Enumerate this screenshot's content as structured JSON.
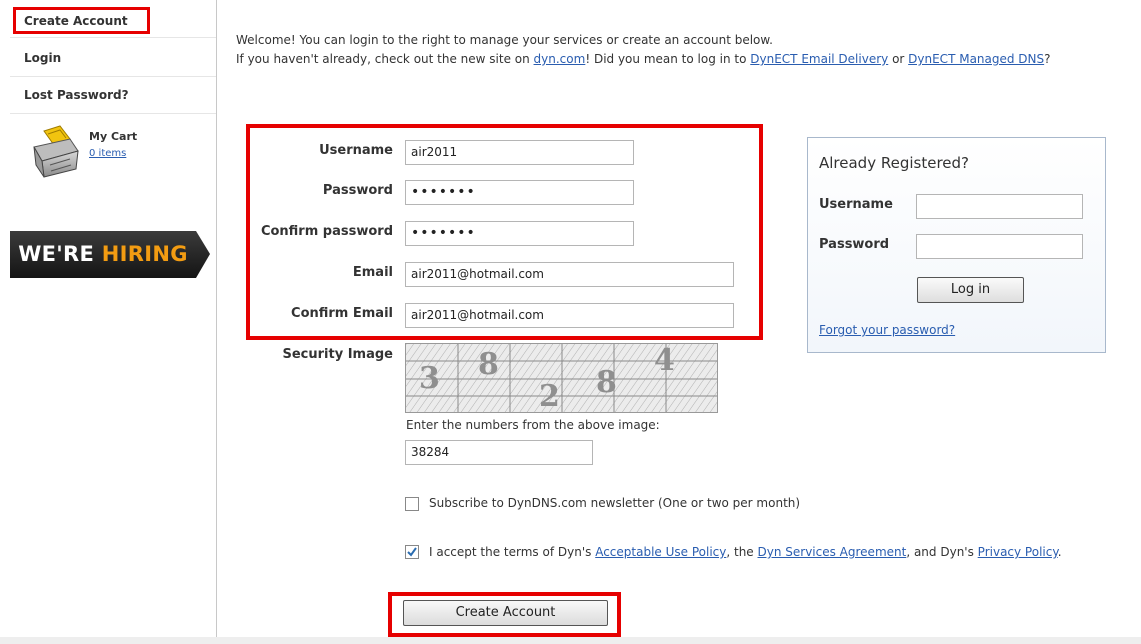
{
  "sidebar": {
    "create_account": "Create Account",
    "login": "Login",
    "lost_password": "Lost Password?",
    "cart_title": "My Cart",
    "cart_items": "0 items",
    "hiring_part1": "WE'RE",
    "hiring_part2": "HIRING"
  },
  "intro": {
    "line1": "Welcome! You can login to the right to manage your services or create an account below.",
    "line2_prefix": "If you haven't already, check out the new site on ",
    "dyn_link": "dyn.com",
    "line2_mid": "! Did you mean to log in to ",
    "email_delivery_link": "DynECT Email Delivery",
    "line2_or": " or ",
    "managed_dns_link": "DynECT Managed DNS",
    "line2_end": "?"
  },
  "form": {
    "username_label": "Username",
    "username_value": "air2011",
    "password_label": "Password",
    "password_value": "•••••••",
    "confirm_password_label": "Confirm password",
    "confirm_password_value": "•••••••",
    "email_label": "Email",
    "email_value": "air2011@hotmail.com",
    "confirm_email_label": "Confirm Email",
    "confirm_email_value": "air2011@hotmail.com",
    "security_label": "Security Image",
    "captcha_digits": [
      "3",
      "8",
      "2",
      "8",
      "4"
    ],
    "captcha_prompt": "Enter the numbers from the above image:",
    "captcha_value": "38284",
    "newsletter_text": "Subscribe to DynDNS.com newsletter (One or two per month)",
    "newsletter_checked": false,
    "terms_prefix": "I accept the terms of Dyn's ",
    "aup_link": "Acceptable Use Policy",
    "terms_mid1": ", the ",
    "dsa_link": "Dyn Services Agreement",
    "terms_mid2": ", and Dyn's ",
    "privacy_link": "Privacy Policy",
    "terms_end": ".",
    "terms_checked": true,
    "submit_label": "Create Account"
  },
  "login_panel": {
    "heading": "Already Registered?",
    "username_label": "Username",
    "password_label": "Password",
    "login_button": "Log in",
    "forgot_link": "Forgot your password?"
  },
  "colors": {
    "highlight_red": "#e60000",
    "link_blue": "#2a5db0",
    "hiring_orange": "#f39c12"
  }
}
